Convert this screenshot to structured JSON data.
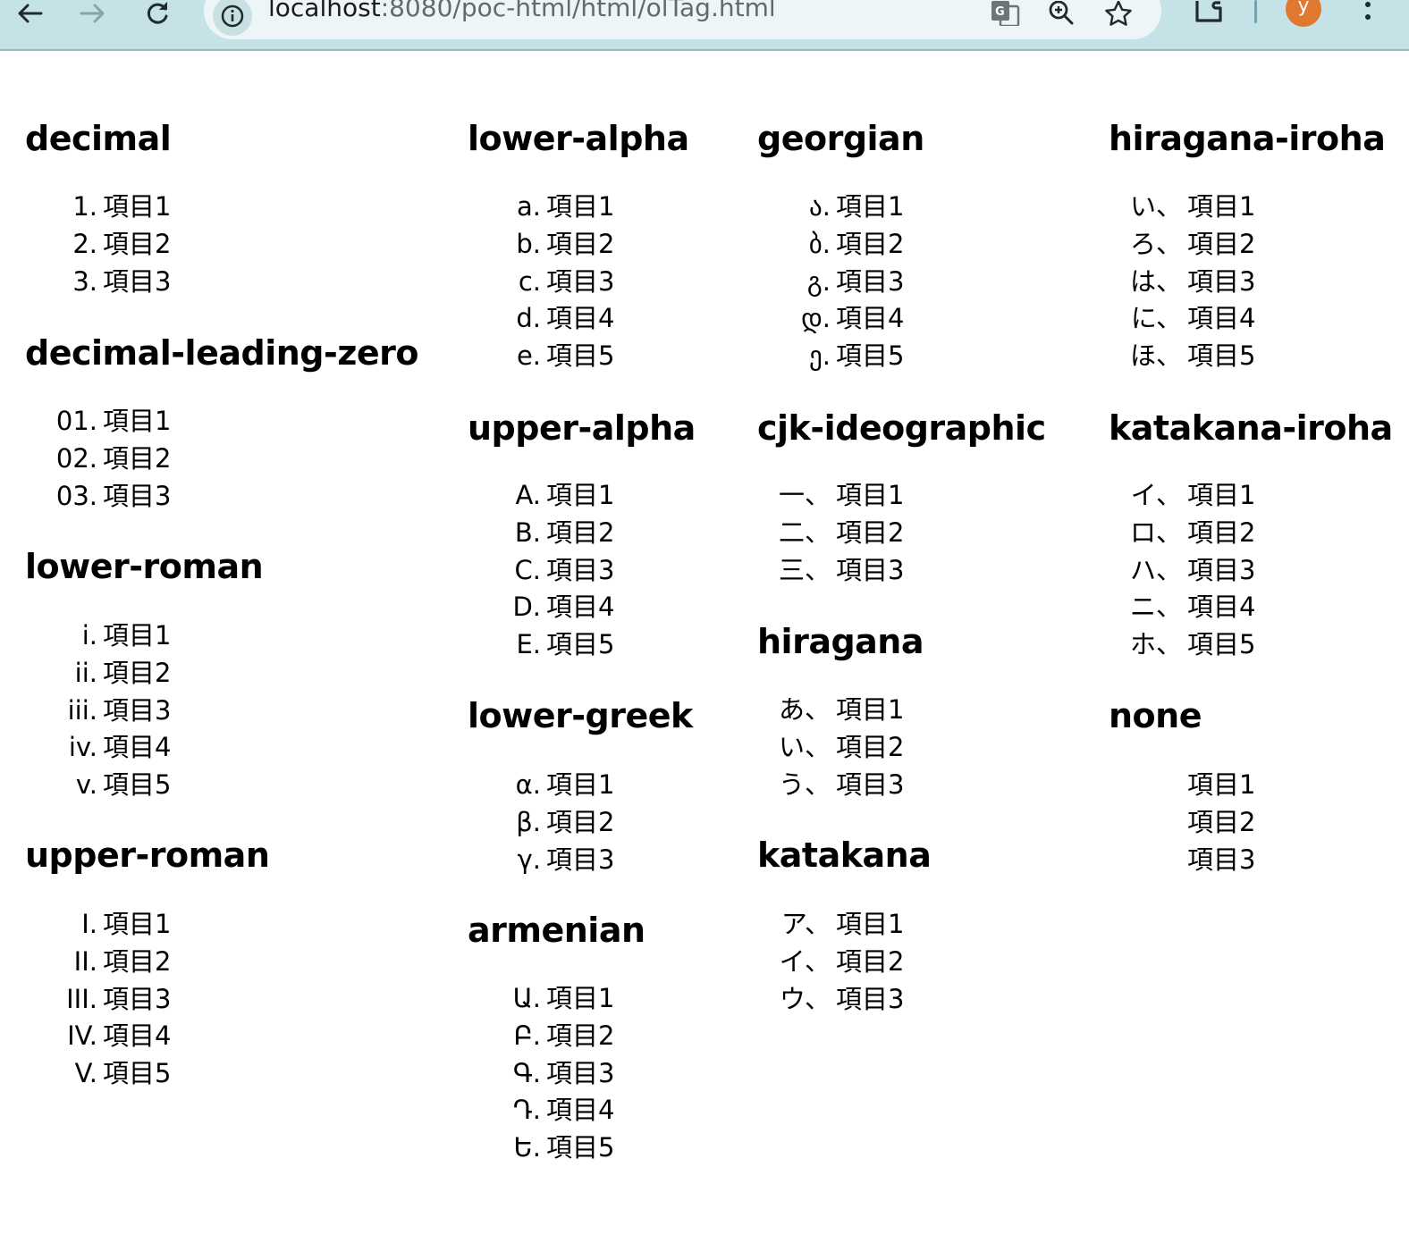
{
  "browser": {
    "url_host": "localhost",
    "url_rest": ":8080/poc-html/html/olTag.html",
    "profile_initial": "y"
  },
  "sections": {
    "decimal": {
      "title": "decimal",
      "markers": [
        "1.",
        "2.",
        "3."
      ],
      "items": [
        "項目1",
        "項目2",
        "項目3"
      ]
    },
    "decimal_leading_zero": {
      "title": "decimal-leading-zero",
      "markers": [
        "01.",
        "02.",
        "03."
      ],
      "items": [
        "項目1",
        "項目2",
        "項目3"
      ]
    },
    "lower_roman": {
      "title": "lower-roman",
      "markers": [
        "i.",
        "ii.",
        "iii.",
        "iv.",
        "v."
      ],
      "items": [
        "項目1",
        "項目2",
        "項目3",
        "項目4",
        "項目5"
      ]
    },
    "upper_roman": {
      "title": "upper-roman",
      "markers": [
        "I.",
        "II.",
        "III.",
        "IV.",
        "V."
      ],
      "items": [
        "項目1",
        "項目2",
        "項目3",
        "項目4",
        "項目5"
      ]
    },
    "lower_alpha": {
      "title": "lower-alpha",
      "markers": [
        "a.",
        "b.",
        "c.",
        "d.",
        "e."
      ],
      "items": [
        "項目1",
        "項目2",
        "項目3",
        "項目4",
        "項目5"
      ]
    },
    "upper_alpha": {
      "title": "upper-alpha",
      "markers": [
        "A.",
        "B.",
        "C.",
        "D.",
        "E."
      ],
      "items": [
        "項目1",
        "項目2",
        "項目3",
        "項目4",
        "項目5"
      ]
    },
    "lower_greek": {
      "title": "lower-greek",
      "markers": [
        "α.",
        "β.",
        "γ."
      ],
      "items": [
        "項目1",
        "項目2",
        "項目3"
      ]
    },
    "armenian": {
      "title": "armenian",
      "markers": [
        "Ա.",
        "Բ.",
        "Գ.",
        "Դ.",
        "Ե."
      ],
      "items": [
        "項目1",
        "項目2",
        "項目3",
        "項目4",
        "項目5"
      ]
    },
    "georgian": {
      "title": "georgian",
      "markers": [
        "ა.",
        "ბ.",
        "გ.",
        "დ.",
        "ე."
      ],
      "items": [
        "項目1",
        "項目2",
        "項目3",
        "項目4",
        "項目5"
      ]
    },
    "cjk_ideographic": {
      "title": "cjk-ideographic",
      "markers": [
        "一、",
        "二、",
        "三、"
      ],
      "items": [
        "項目1",
        "項目2",
        "項目3"
      ]
    },
    "hiragana": {
      "title": "hiragana",
      "markers": [
        "あ、",
        "い、",
        "う、"
      ],
      "items": [
        "項目1",
        "項目2",
        "項目3"
      ]
    },
    "katakana": {
      "title": "katakana",
      "markers": [
        "ア、",
        "イ、",
        "ウ、"
      ],
      "items": [
        "項目1",
        "項目2",
        "項目3"
      ]
    },
    "hiragana_iroha": {
      "title": "hiragana-iroha",
      "markers": [
        "い、",
        "ろ、",
        "は、",
        "に、",
        "ほ、"
      ],
      "items": [
        "項目1",
        "項目2",
        "項目3",
        "項目4",
        "項目5"
      ]
    },
    "katakana_iroha": {
      "title": "katakana-iroha",
      "markers": [
        "イ、",
        "ロ、",
        "ハ、",
        "ニ、",
        "ホ、"
      ],
      "items": [
        "項目1",
        "項目2",
        "項目3",
        "項目4",
        "項目5"
      ]
    },
    "none": {
      "title": "none",
      "markers": [
        "",
        "",
        ""
      ],
      "items": [
        "項目1",
        "項目2",
        "項目3"
      ]
    }
  }
}
